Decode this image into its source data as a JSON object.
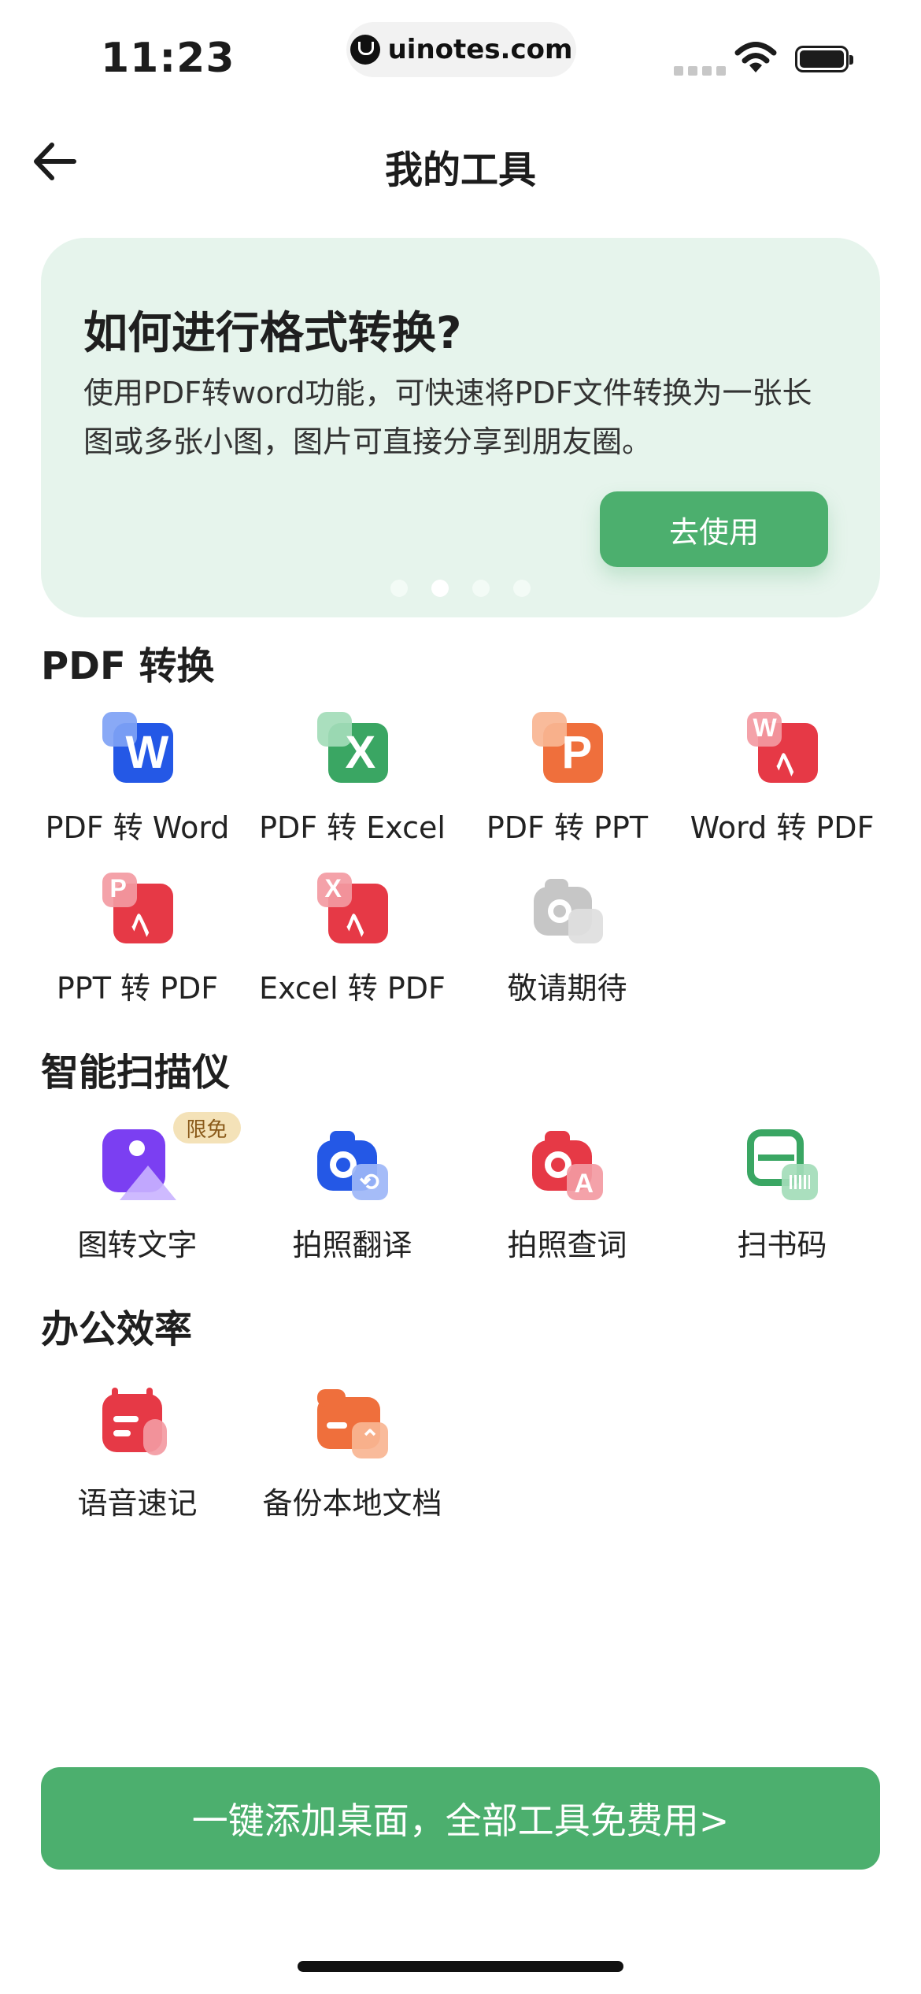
{
  "status_bar": {
    "time": "11:23",
    "url": "uinotes.com"
  },
  "nav": {
    "title": "我的工具"
  },
  "banner": {
    "title": "如何进行格式转换?",
    "description": "使用PDF转word功能，可快速将PDF文件转换为一张长图或多张小图，图片可直接分享到朋友圈。",
    "button": "去使用",
    "dots": 4,
    "active_dot": 2
  },
  "sections": {
    "pdf": {
      "title": "PDF 转换",
      "items": [
        "PDF 转 Word",
        "PDF 转 Excel",
        "PDF 转 PPT",
        "Word 转 PDF",
        "PPT 转 PDF",
        "Excel 转 PDF",
        "敬请期待"
      ]
    },
    "scan": {
      "title": "智能扫描仪",
      "badge": "限免",
      "items": [
        "图转文字",
        "拍照翻译",
        "拍照查词",
        "扫书码"
      ]
    },
    "office": {
      "title": "办公效率",
      "items": [
        "语音速记",
        "备份本地文档"
      ]
    }
  },
  "cta": {
    "label": "一键添加桌面，全部工具免费用>"
  },
  "colors": {
    "accent": "#4caf6e",
    "banner_bg": "#e6f4ec"
  }
}
